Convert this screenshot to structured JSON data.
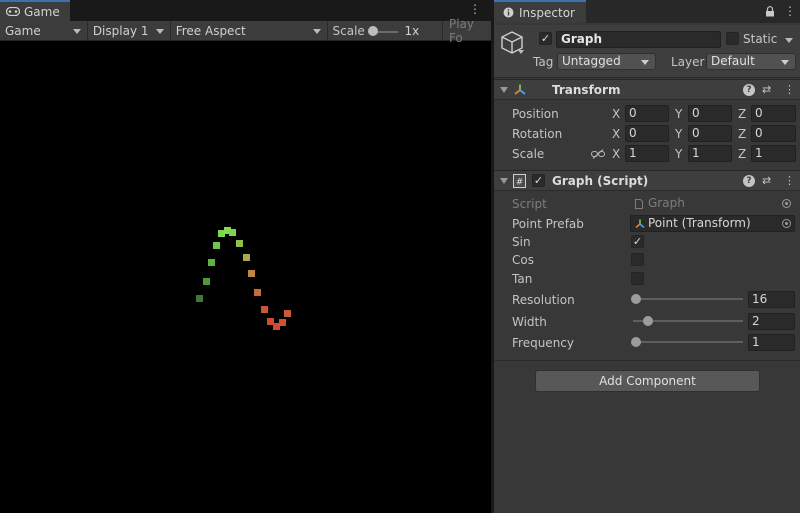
{
  "game": {
    "tab_label": "Game",
    "toolbar": {
      "mode": "Game",
      "display": "Display 1",
      "aspect": "Free Aspect",
      "scale_label": "Scale",
      "scale_value": "1x",
      "play_focused": "Play Fo"
    },
    "points": [
      {
        "color": "#3e7a35"
      },
      {
        "color": "#4c9a3c"
      },
      {
        "color": "#5cb341"
      },
      {
        "color": "#6dc846"
      },
      {
        "color": "#7ed64b"
      },
      {
        "color": "#87dc4e"
      },
      {
        "color": "#80d24c"
      },
      {
        "color": "#8dbf49"
      },
      {
        "color": "#a8a94c"
      },
      {
        "color": "#bf8745"
      },
      {
        "color": "#c86a3c"
      },
      {
        "color": "#cc5534"
      },
      {
        "color": "#d04b2f"
      },
      {
        "color": "#ce4d30"
      },
      {
        "color": "#d1512f"
      },
      {
        "color": "#c85b37"
      }
    ]
  },
  "inspector": {
    "tab_label": "Inspector",
    "object": {
      "active": true,
      "name": "Graph",
      "static_label": "Static",
      "static": false,
      "tag_label": "Tag",
      "tag": "Untagged",
      "layer_label": "Layer",
      "layer": "Default"
    },
    "transform": {
      "title": "Transform",
      "rows": [
        {
          "label": "Position",
          "x": "0",
          "y": "0",
          "z": "0"
        },
        {
          "label": "Rotation",
          "x": "0",
          "y": "0",
          "z": "0"
        },
        {
          "label": "Scale",
          "x": "1",
          "y": "1",
          "z": "1"
        }
      ],
      "axis_x": "X",
      "axis_y": "Y",
      "axis_z": "Z"
    },
    "graph_script": {
      "title": "Graph (Script)",
      "enabled": true,
      "script_label": "Script",
      "script_value": "Graph",
      "point_prefab_label": "Point Prefab",
      "point_prefab_value": "Point (Transform)",
      "sin_label": "Sin",
      "sin": true,
      "cos_label": "Cos",
      "cos": false,
      "tan_label": "Tan",
      "tan": false,
      "resolution_label": "Resolution",
      "resolution": "16",
      "resolution_fraction": 0.0,
      "width_label": "Width",
      "width": "2",
      "width_fraction": 0.11,
      "frequency_label": "Frequency",
      "frequency": "1",
      "frequency_fraction": 0.0
    },
    "add_component_label": "Add Component"
  }
}
